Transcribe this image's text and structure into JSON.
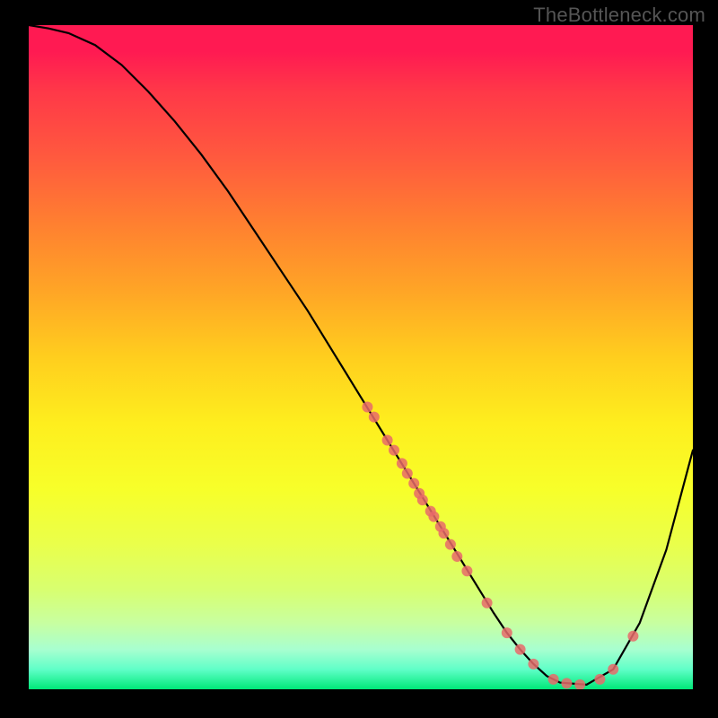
{
  "watermark": "TheBottleneck.com",
  "chart_data": {
    "type": "line",
    "title": "",
    "xlabel": "",
    "ylabel": "",
    "xlim": [
      0,
      100
    ],
    "ylim": [
      0,
      100
    ],
    "curve": {
      "name": "bottleneck-curve",
      "x": [
        0,
        3,
        6,
        10,
        14,
        18,
        22,
        26,
        30,
        34,
        38,
        42,
        46,
        50,
        54,
        58,
        62,
        66,
        70,
        72,
        74,
        76,
        78,
        80,
        84,
        88,
        92,
        96,
        100
      ],
      "y": [
        100,
        99.5,
        98.8,
        97,
        94,
        90,
        85.5,
        80.5,
        75,
        69,
        63,
        57,
        50.5,
        44,
        37.5,
        31,
        24.5,
        18,
        11.5,
        8.5,
        6,
        3.8,
        2,
        1,
        0.7,
        3,
        10,
        21,
        36
      ]
    },
    "points": {
      "name": "data-points",
      "marker_color": "#e86a6a",
      "xy": [
        [
          51,
          42.5
        ],
        [
          52,
          41
        ],
        [
          54,
          37.5
        ],
        [
          55,
          36
        ],
        [
          56.2,
          34
        ],
        [
          57,
          32.5
        ],
        [
          58,
          31
        ],
        [
          58.8,
          29.5
        ],
        [
          59.3,
          28.5
        ],
        [
          60.5,
          26.8
        ],
        [
          61,
          26
        ],
        [
          62,
          24.5
        ],
        [
          62.5,
          23.5
        ],
        [
          63.5,
          21.8
        ],
        [
          64.5,
          20
        ],
        [
          66,
          17.8
        ],
        [
          69,
          13
        ],
        [
          72,
          8.5
        ],
        [
          74,
          6
        ],
        [
          76,
          3.8
        ],
        [
          79,
          1.5
        ],
        [
          81,
          0.9
        ],
        [
          83,
          0.7
        ],
        [
          86,
          1.5
        ],
        [
          88,
          3
        ],
        [
          91,
          8
        ]
      ]
    },
    "colormap": {
      "type": "vertical-gradient",
      "stops": [
        {
          "pos": 0.0,
          "color": "#ff1a52"
        },
        {
          "pos": 0.5,
          "color": "#ffd81e"
        },
        {
          "pos": 0.8,
          "color": "#ecff40"
        },
        {
          "pos": 1.0,
          "color": "#00e878"
        }
      ]
    }
  }
}
